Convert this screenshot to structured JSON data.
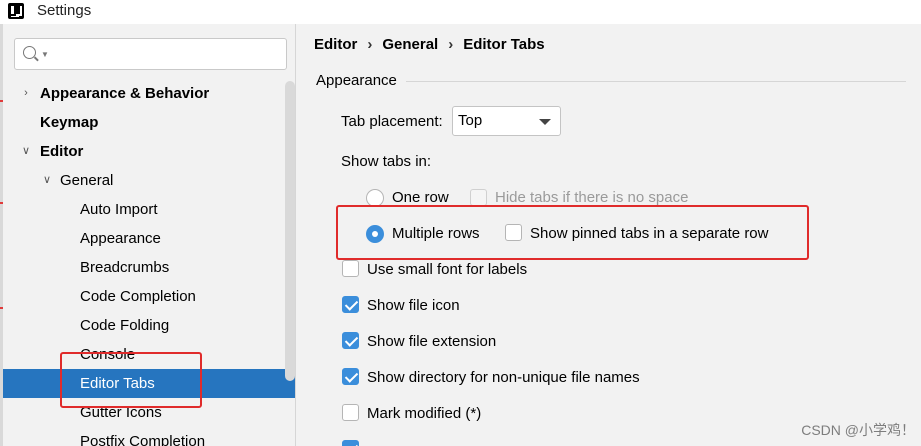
{
  "window": {
    "title": "Settings",
    "app_icon": "intellij-icon"
  },
  "sidebar": {
    "search": {
      "placeholder": "",
      "value": "",
      "icon": "search-icon"
    },
    "items": [
      {
        "label": "Appearance & Behavior",
        "bold": true,
        "arrow": ">",
        "name": "sidebar-item-appearance-behavior"
      },
      {
        "label": "Keymap",
        "bold": true,
        "arrow": "",
        "name": "sidebar-item-keymap"
      },
      {
        "label": "Editor",
        "bold": true,
        "arrow": "v",
        "name": "sidebar-item-editor"
      },
      {
        "label": "General",
        "bold": false,
        "arrow": "v",
        "name": "sidebar-item-general"
      },
      {
        "label": "Auto Import",
        "bold": false,
        "arrow": "",
        "name": "sidebar-item-auto-import"
      },
      {
        "label": "Appearance",
        "bold": false,
        "arrow": "",
        "name": "sidebar-item-appearance"
      },
      {
        "label": "Breadcrumbs",
        "bold": false,
        "arrow": "",
        "name": "sidebar-item-breadcrumbs"
      },
      {
        "label": "Code Completion",
        "bold": false,
        "arrow": "",
        "name": "sidebar-item-code-completion"
      },
      {
        "label": "Code Folding",
        "bold": false,
        "arrow": "",
        "name": "sidebar-item-code-folding"
      },
      {
        "label": "Console",
        "bold": false,
        "arrow": "",
        "name": "sidebar-item-console"
      },
      {
        "label": "Editor Tabs",
        "bold": false,
        "arrow": "",
        "selected": true,
        "name": "sidebar-item-editor-tabs"
      },
      {
        "label": "Gutter Icons",
        "bold": false,
        "arrow": "",
        "name": "sidebar-item-gutter-icons"
      },
      {
        "label": "Postfix Completion",
        "bold": false,
        "arrow": "",
        "name": "sidebar-item-postfix-completion"
      }
    ]
  },
  "content": {
    "breadcrumb": [
      "Editor",
      "General",
      "Editor Tabs"
    ],
    "group_title": "Appearance",
    "tab_placement": {
      "label": "Tab placement:",
      "value": "Top"
    },
    "show_tabs_in": {
      "label": "Show tabs in:"
    },
    "options": {
      "one_row": {
        "label": "One row",
        "checked": false
      },
      "hide_tabs": {
        "label": "Hide tabs if there is no space",
        "checked": false,
        "disabled": true
      },
      "multiple_rows": {
        "label": "Multiple rows",
        "checked": true
      },
      "pinned_separate": {
        "label": "Show pinned tabs in a separate row",
        "checked": false
      },
      "small_font": {
        "label": "Use small font for labels",
        "checked": false
      },
      "file_icon": {
        "label": "Show file icon",
        "checked": true
      },
      "file_extension": {
        "label": "Show file extension",
        "checked": true
      },
      "directory": {
        "label": "Show directory for non-unique file names",
        "checked": true
      },
      "mark_modified": {
        "label": "Mark modified (*)",
        "checked": false
      }
    }
  },
  "watermark": "CSDN @小学鸡！",
  "colors": {
    "selection": "#2675bf",
    "accent": "#3b8edb",
    "annotation": "#e02b2b"
  }
}
